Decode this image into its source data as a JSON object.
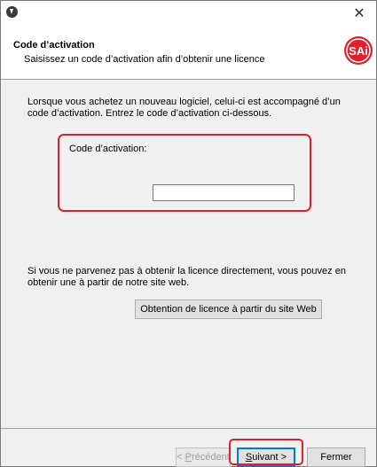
{
  "window": {
    "close_glyph": "✕",
    "app_icon": "download-circle-icon"
  },
  "header": {
    "title": "Code d’activation",
    "subtitle": "Saisissez un code d’activation afin d’obtenir une licence",
    "logo_text": "SAi",
    "logo_color": "#e0212d"
  },
  "content": {
    "intro": "Lorsque vous achetez un nouveau logiciel, celui-ci est accompagné d’un code d’activation.  Entrez le code d’activation ci-dessous.",
    "code_label": "Code d’activation:",
    "code_value": "",
    "web_info": "Si vous  ne parvenez pas à obtenir la licence directement, vous pouvez en obtenir une à partir de notre site web.",
    "web_button": "Obtention de licence à partir du site Web"
  },
  "footer": {
    "prev_mnemonic": "P",
    "prev_rest": "récédent",
    "prev_prefix": "< ",
    "next_mnemonic": "S",
    "next_rest": "uivant >",
    "close_label": "Fermer"
  },
  "colors": {
    "highlight": "#e0212d",
    "panel": "#f0f0f0",
    "focus": "#0078d7"
  }
}
